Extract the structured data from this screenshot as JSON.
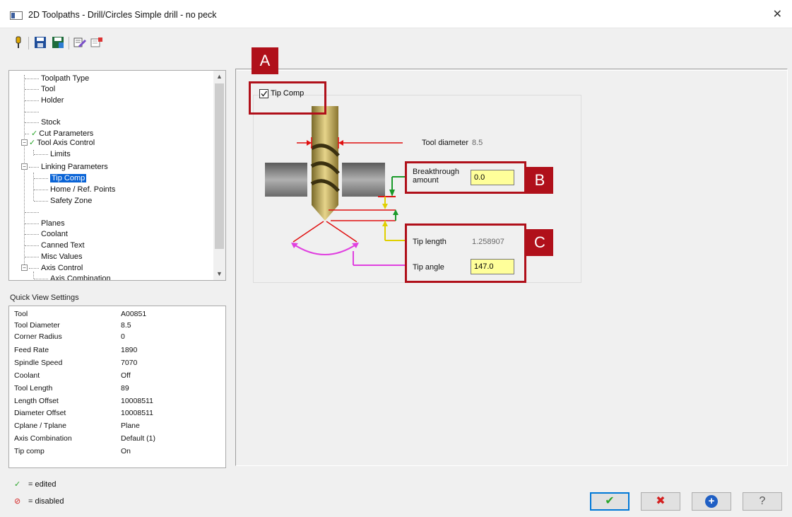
{
  "window": {
    "title": "2D Toolpaths - Drill/Circles Simple drill - no peck",
    "close_glyph": "✕"
  },
  "toolbar": {
    "icons": [
      "tool-pin-icon",
      "save-icon",
      "save-all-icon",
      "edit-icon",
      "clear-icon"
    ]
  },
  "tree": {
    "items": [
      {
        "label": "Toolpath Type"
      },
      {
        "label": "Tool"
      },
      {
        "label": "Holder"
      },
      {
        "label": ""
      },
      {
        "label": "Stock"
      },
      {
        "label": "Cut Parameters",
        "check": "✓"
      },
      {
        "label": "Tool Axis Control",
        "check": "✓",
        "toggle": "−"
      },
      {
        "label": "Limits"
      },
      {
        "label": "Linking Parameters",
        "toggle": "−"
      },
      {
        "label": "Tip Comp",
        "selected": true
      },
      {
        "label": "Home / Ref. Points"
      },
      {
        "label": "Safety Zone"
      },
      {
        "label": ""
      },
      {
        "label": "Planes"
      },
      {
        "label": "Coolant"
      },
      {
        "label": "Canned Text"
      },
      {
        "label": "Misc Values"
      },
      {
        "label": "Axis Control",
        "toggle": "−"
      },
      {
        "label": "Axis Combination"
      }
    ],
    "scroll_up": "▲",
    "scroll_down": "▼"
  },
  "quick_view": {
    "title": "Quick View Settings",
    "rows": [
      {
        "k": "Tool",
        "v": "A00851"
      },
      {
        "k": "Tool Diameter",
        "v": "8.5"
      },
      {
        "k": "Corner Radius",
        "v": "0"
      },
      {
        "k": "Feed Rate",
        "v": "1890"
      },
      {
        "k": "Spindle Speed",
        "v": "7070"
      },
      {
        "k": "Coolant",
        "v": "Off"
      },
      {
        "k": "Tool Length",
        "v": "89"
      },
      {
        "k": "Length Offset",
        "v": "10008511"
      },
      {
        "k": "Diameter Offset",
        "v": "10008511"
      },
      {
        "k": "Cplane / Tplane",
        "v": "Plane"
      },
      {
        "k": "Axis Combination",
        "v": "Default (1)"
      },
      {
        "k": "Tip comp",
        "v": "On"
      }
    ]
  },
  "legend": {
    "edited_symbol": "✓",
    "edited_label": "= edited",
    "disabled_symbol": "⊘",
    "disabled_label": "= disabled"
  },
  "tip_comp": {
    "checkbox_label": "Tip Comp",
    "checked": true,
    "check_glyph": "✓",
    "tool_diameter_label": "Tool diameter",
    "tool_diameter_value": "8.5",
    "breakthrough_label_1": "Breakthrough",
    "breakthrough_label_2": "amount",
    "breakthrough_value": "0.0",
    "tip_length_label": "Tip length",
    "tip_length_value": "1.258907",
    "tip_angle_label": "Tip angle",
    "tip_angle_value": "147.0"
  },
  "callouts": {
    "a": "A",
    "b": "B",
    "c": "C"
  },
  "colors": {
    "callout": "#b0101a",
    "input_bg": "#ffff9a",
    "selection": "#0a64d6",
    "drill_gold": "#c9a94a"
  },
  "buttons": {
    "ok": "✔",
    "cancel": "✖",
    "apply": "+",
    "help": "?"
  }
}
